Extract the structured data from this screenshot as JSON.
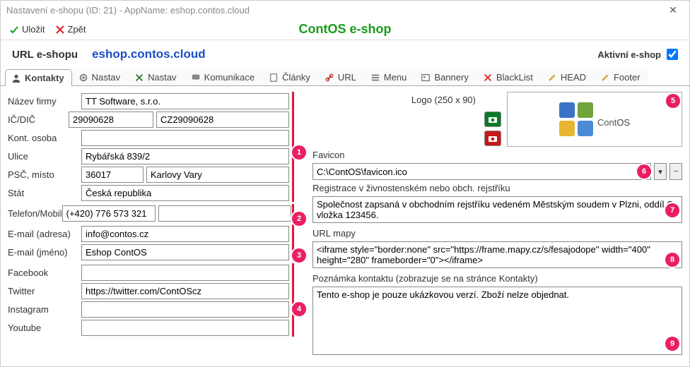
{
  "window": {
    "title": "Nastavení e-shopu  (ID: 21)  -  AppName: eshop.contos.cloud"
  },
  "toolbar": {
    "save": "Uložit",
    "back": "Zpět",
    "brand": "ContOS e-shop"
  },
  "header": {
    "urlLabel": "URL e-shopu",
    "urlValue": "eshop.contos.cloud",
    "activeLabel": "Aktivní e-shop"
  },
  "tabs": [
    {
      "label": "Kontakty",
      "icon": "user"
    },
    {
      "label": "Nastav",
      "icon": "gear"
    },
    {
      "label": "Nastav",
      "icon": "tools"
    },
    {
      "label": "Komunikace",
      "icon": "chat"
    },
    {
      "label": "Články",
      "icon": "doc"
    },
    {
      "label": "URL",
      "icon": "link"
    },
    {
      "label": "Menu",
      "icon": "menu"
    },
    {
      "label": "Bannery",
      "icon": "image"
    },
    {
      "label": "BlackList",
      "icon": "x"
    },
    {
      "label": "HEAD",
      "icon": "pencil"
    },
    {
      "label": "Footer",
      "icon": "pencil"
    }
  ],
  "left": {
    "company": {
      "label": "Název firmy",
      "value": "TT Software, s.r.o."
    },
    "ic": {
      "label": "IČ/DIČ",
      "ic": "29090628",
      "dic": "CZ29090628"
    },
    "contact": {
      "label": "Kont. osoba",
      "value": ""
    },
    "street": {
      "label": "Ulice",
      "value": "Rybářská 839/2"
    },
    "zipcity": {
      "label": "PSČ, místo",
      "zip": "36017",
      "city": "Karlovy Vary"
    },
    "state": {
      "label": "Stát",
      "value": "Česká republika"
    },
    "phone": {
      "label": "Telefon/Mobil",
      "phone": "(+420) 776 573 321",
      "mobile": ""
    },
    "email_addr": {
      "label": "E-mail (adresa)",
      "value": "info@contos.cz"
    },
    "email_name": {
      "label": "E-mail (jméno)",
      "value": "Eshop ContOS"
    },
    "facebook": {
      "label": "Facebook",
      "value": ""
    },
    "twitter": {
      "label": "Twitter",
      "value": "https://twitter.com/ContOScz"
    },
    "instagram": {
      "label": "Instagram",
      "value": ""
    },
    "youtube": {
      "label": "Youtube",
      "value": ""
    }
  },
  "right": {
    "logoLabel": "Logo (250 x 90)",
    "logoText1": "Cont",
    "logoText2": "OS",
    "favLabel": "Favicon",
    "favValue": "C:\\ContOS\\favicon.ico",
    "regLabel": "Registrace v živnostenském nebo obch. rejstříku",
    "regValue": "Společnost zapsaná v obchodním rejstříku vedeném Městským soudem v Plzni, oddíl C, vložka 123456.",
    "mapLabel": "URL mapy",
    "mapValue": "<iframe style=\"border:none\" src=\"https://frame.mapy.cz/s/fesajodope\" width=\"400\" height=\"280\" frameborder=\"0\"></iframe>",
    "noteLabel": "Poznámka kontaktu (zobrazuje se na stránce Kontakty)",
    "noteValue": "Tento e-shop je pouze ukázkovou verzí. Zboží nelze objednat."
  },
  "badges": [
    "1",
    "2",
    "3",
    "4",
    "5",
    "6",
    "7",
    "8",
    "9"
  ]
}
